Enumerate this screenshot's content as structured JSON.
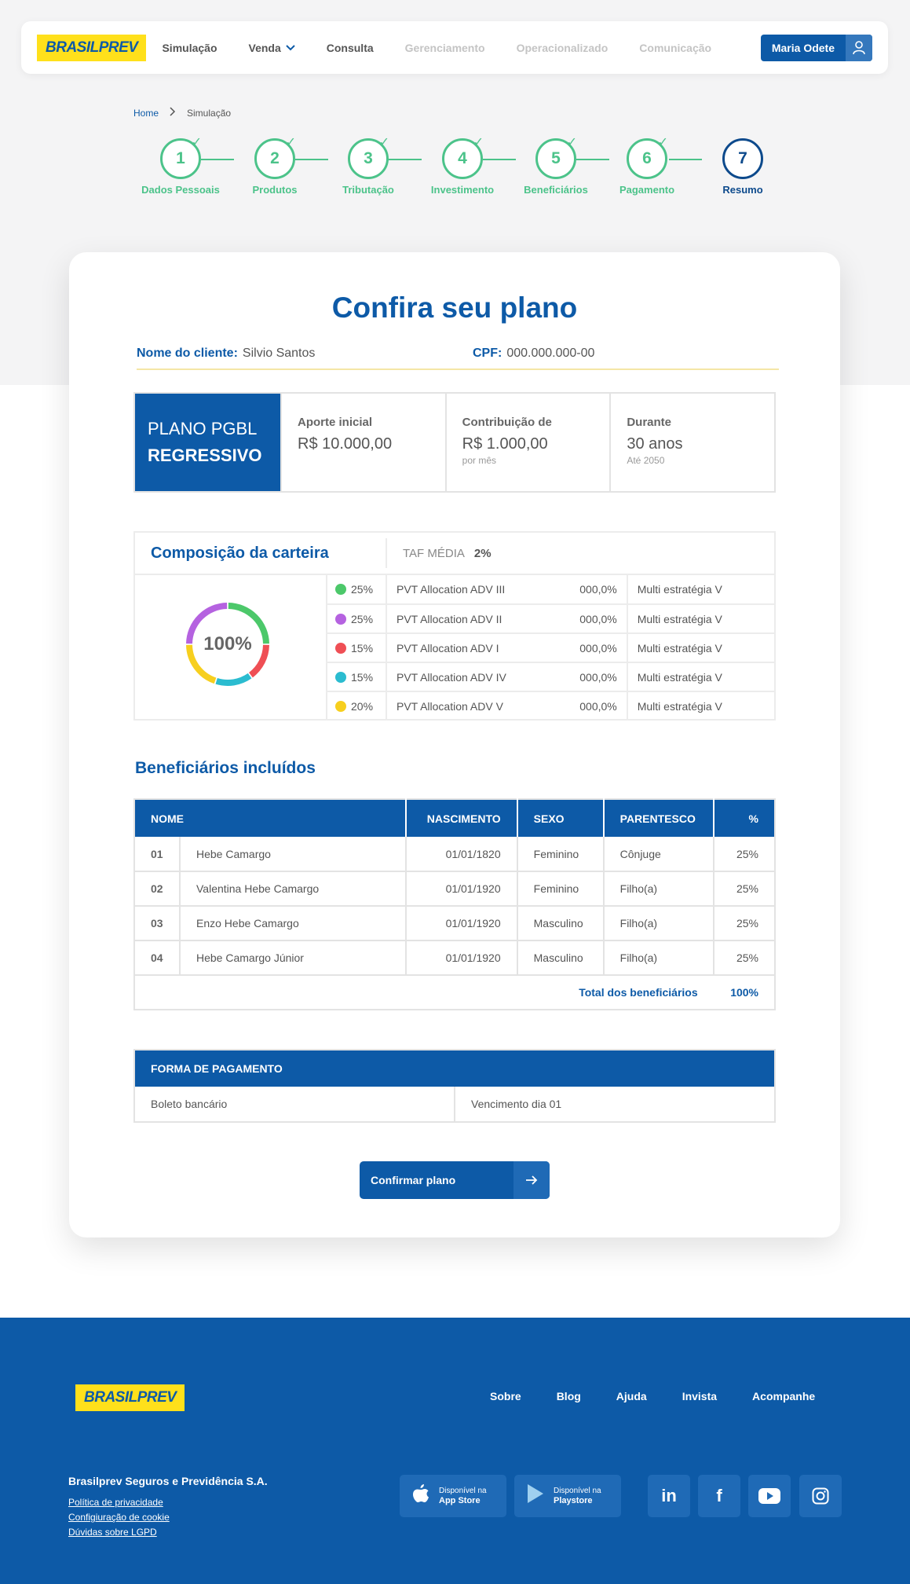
{
  "header": {
    "logo": "BRASILPREV",
    "nav": [
      {
        "label": "Simulação",
        "disabled": false
      },
      {
        "label": "Venda",
        "disabled": false,
        "dropdown": true
      },
      {
        "label": "Consulta",
        "disabled": false
      },
      {
        "label": "Gerenciamento",
        "disabled": true
      },
      {
        "label": "Operacionalizado",
        "disabled": true
      },
      {
        "label": "Comunicação",
        "disabled": true
      }
    ],
    "user_name": "Maria Odete"
  },
  "breadcrumb": {
    "home": "Home",
    "current": "Simulação"
  },
  "stepper": [
    {
      "num": "1",
      "label": "Dados Pessoais",
      "done": true
    },
    {
      "num": "2",
      "label": "Produtos",
      "done": true
    },
    {
      "num": "3",
      "label": "Tributação",
      "done": true
    },
    {
      "num": "4",
      "label": "Investimento",
      "done": true
    },
    {
      "num": "5",
      "label": "Beneficiários",
      "done": true
    },
    {
      "num": "6",
      "label": "Pagamento",
      "done": true
    },
    {
      "num": "7",
      "label": "Resumo",
      "done": false
    }
  ],
  "card": {
    "title": "Confira seu plano",
    "client_label": "Nome do cliente:",
    "client_name": "Silvio Santos",
    "cpf_label": "CPF:",
    "cpf_value": "000.000.000-00"
  },
  "plan": {
    "name_line1": "PLANO PGBL",
    "name_line2": "REGRESSIVO",
    "aporte_label": "Aporte inicial",
    "aporte_value": "R$ 10.000,00",
    "contrib_label": "Contribuição de",
    "contrib_value": "R$ 1.000,00",
    "contrib_sub": "por mês",
    "durante_label": "Durante",
    "durante_value": "30 anos",
    "durante_sub": "Até 2050"
  },
  "composition": {
    "title": "Composição da carteira",
    "taf_label": "TAF MÉDIA",
    "taf_value": "2%",
    "total": "100%",
    "items": [
      {
        "pct": "25%",
        "fund": "PVT Allocation ADV III",
        "value": "000,0%",
        "strategy": "Multi estratégia V",
        "color": "#4cc86a",
        "share": 25
      },
      {
        "pct": "25%",
        "fund": "PVT Allocation ADV II",
        "value": "000,0%",
        "strategy": "Multi estratégia V",
        "color": "#b562e0",
        "share": 25
      },
      {
        "pct": "15%",
        "fund": "PVT Allocation ADV I",
        "value": "000,0%",
        "strategy": "Multi estratégia V",
        "color": "#ef4f55",
        "share": 15
      },
      {
        "pct": "15%",
        "fund": "PVT Allocation ADV IV",
        "value": "000,0%",
        "strategy": "Multi estratégia V",
        "color": "#2bbcd0",
        "share": 15
      },
      {
        "pct": "20%",
        "fund": "PVT Allocation ADV V",
        "value": "000,0%",
        "strategy": "Multi estratégia V",
        "color": "#f7cf1e",
        "share": 20
      }
    ]
  },
  "beneficiaries": {
    "title": "Beneficiários incluídos",
    "headers": {
      "nome": "NOME",
      "nascimento": "NASCIMENTO",
      "sexo": "SEXO",
      "parentesco": "PARENTESCO",
      "pct": "%"
    },
    "rows": [
      {
        "num": "01",
        "nome": "Hebe Camargo",
        "nascimento": "01/01/1820",
        "sexo": "Feminino",
        "parentesco": "Cônjuge",
        "pct": "25%"
      },
      {
        "num": "02",
        "nome": "Valentina Hebe Camargo",
        "nascimento": "01/01/1920",
        "sexo": "Feminino",
        "parentesco": "Filho(a)",
        "pct": "25%"
      },
      {
        "num": "03",
        "nome": "Enzo Hebe Camargo",
        "nascimento": "01/01/1920",
        "sexo": "Masculino",
        "parentesco": "Filho(a)",
        "pct": "25%"
      },
      {
        "num": "04",
        "nome": "Hebe Camargo Júnior",
        "nascimento": "01/01/1920",
        "sexo": "Masculino",
        "parentesco": "Filho(a)",
        "pct": "25%"
      }
    ],
    "total_label": "Total dos beneficiários",
    "total_value": "100%"
  },
  "payment": {
    "title": "FORMA DE PAGAMENTO",
    "method": "Boleto bancário",
    "due": "Vencimento dia 01"
  },
  "confirm_label": "Confirmar plano",
  "footer": {
    "logo": "BRASILPREV",
    "nav": [
      "Sobre",
      "Blog",
      "Ajuda",
      "Invista",
      "Acompanhe"
    ],
    "company": "Brasilprev Seguros e Previdência S.A.",
    "links": [
      "Política de privacidade",
      "Configiuração de cookie",
      "Dúvidas sobre LGPD"
    ],
    "appstore_small": "Disponível na",
    "appstore_big": "App Store",
    "playstore_small": "Disponível na",
    "playstore_big": "Playstore",
    "social": [
      "linkedin-icon",
      "facebook-icon",
      "youtube-icon",
      "instagram-icon"
    ]
  }
}
